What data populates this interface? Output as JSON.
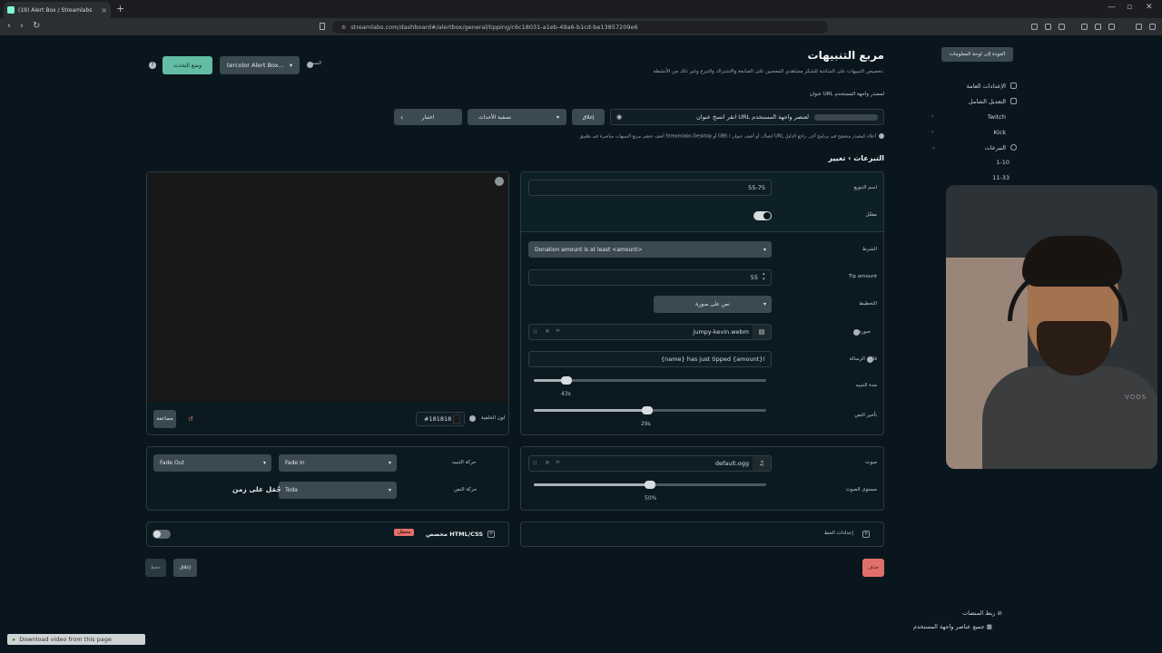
{
  "browser": {
    "tab_title": "(19) Alert Box / Streamlabs",
    "url": "streamlabs.com/dashboard#/alertbox/general/tipping/c6c18031-a1eb-49a6-b1cd-be13857209e6"
  },
  "header": {
    "title": "مربع التنبيهات",
    "subtitle": "تخصيص التنبيهات على الشاشة للشكر مشاهدي المعجبين على المتابعة والاشتراك والتبرع وغير ذلك من الأنشطة.",
    "back_button": "العودة إلى لوحة المعلومات",
    "theme_label": "السمة",
    "theme_value": "tercolor Alert Box...",
    "preview_button": "وضع التحذث"
  },
  "sidebar": {
    "items": [
      {
        "label": "الإعدادات العامة",
        "icon": "gear-icon"
      },
      {
        "label": "التعديل الشامل",
        "icon": "grid-icon"
      },
      {
        "label": "Twitch",
        "icon": ""
      },
      {
        "label": "Kick",
        "icon": ""
      },
      {
        "label": "التبرعات",
        "icon": "donation-icon"
      }
    ],
    "sub_items": [
      "1-10",
      "11-33"
    ]
  },
  "widget_url": {
    "label": "عنوان URL لمصدر واجهة المستخدم",
    "placeholder": "انقر انسخ عنوان URL لعنصر واجهة المستخدم",
    "lock_button": "إغلاق",
    "filter_label": "تصفية الأحداث",
    "test_label": "اختبار",
    "info": "أضف عنصر مربع التنبيهات مباشرة في تطبيق Streamlabs Desktop أو OBS / اتصال. أو أضف عنوان URL أعلاه كمصدر متصفح في برنامج آخر. راجع الدليل"
  },
  "section": {
    "title": "التبرعات › تغيير"
  },
  "preview": {
    "bg_color_label": "لون الخلفية",
    "bg_color_value": "#181818",
    "duplicate_button": "مضاعفة"
  },
  "settings": {
    "name_label": "اسم التنويع",
    "name_value": "55-75",
    "enabled_label": "مفعّل",
    "condition_label": "الشرط",
    "condition_value": "Donation amount is at least <amount>",
    "tip_amount_label": "Tip amount",
    "tip_amount_value": "55",
    "layout_label": "التخطيط",
    "layout_value": "نص على صورة",
    "image_label": "صورة",
    "image_file": "jumpy-kevin.webm",
    "message_label": "قالب الرسالة",
    "message_value": "{name} has just tipped {amount}!",
    "duration_label": "مدة التنبيه",
    "duration_value": "43s",
    "duration_pct": 0.14,
    "text_delay_label": "تأخير النص",
    "text_delay_value": "29s",
    "text_delay_pct": 0.49
  },
  "animation": {
    "alert_anim_label": "حركة التنبيه",
    "alert_in": "Fade In",
    "alert_out": "Fade Out",
    "text_anim_label": "حركة النص",
    "text_anim_value": "Toda",
    "text_anim_preview": "جُمَل على زمن"
  },
  "sound": {
    "sound_label": "صوت",
    "sound_file": "default.ogg",
    "volume_label": "مستوى الصوت",
    "volume_value": "50%",
    "volume_pct": 0.5
  },
  "custom": {
    "html_label": "مخصص HTML/CSS",
    "html_badge": "معطل",
    "font_label": "إعدادات الخط"
  },
  "actions": {
    "delete": "حذف",
    "close": "إغلاق",
    "save": "حفظ"
  },
  "footer": {
    "platforms": "ربط المنصات",
    "all_widgets": "جميع عناصر واجهة المستخدم"
  },
  "download_bar": "Download video from this page",
  "webcam_brand": "VOOS",
  "colors": {
    "background": "#09161d",
    "accent": "#80f5d2",
    "danger": "#e2706a",
    "preview_bg": "#181818"
  }
}
